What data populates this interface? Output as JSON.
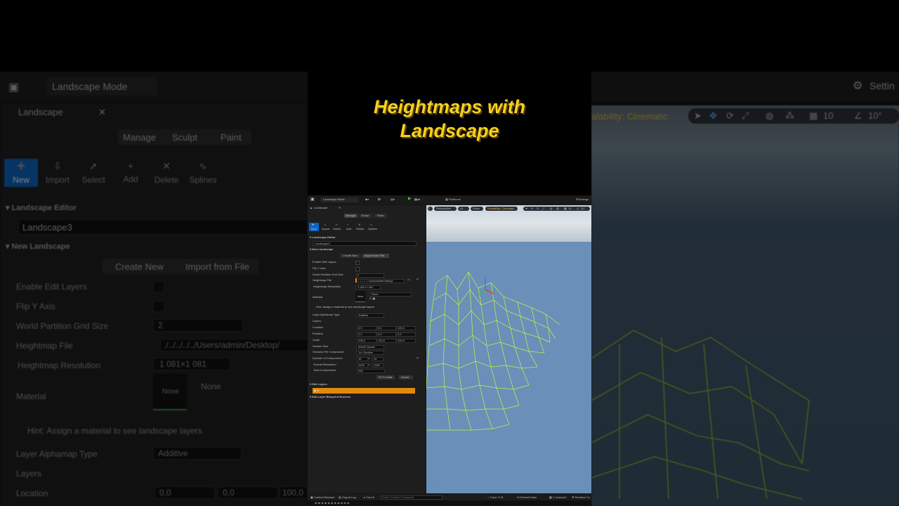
{
  "title": {
    "line1": "Heightmaps with",
    "line2": "Landscape"
  },
  "background": {
    "mode_label": "Landscape Mode",
    "settings_label": "Settin",
    "scalability_label": "alability: Cinematic",
    "panel_tab": "Landscape",
    "tabs": [
      "Manage",
      "Sculpt",
      "Paint"
    ],
    "tools": [
      "New",
      "Import",
      "Select",
      "Add",
      "Delete",
      "Splines"
    ],
    "section_editor": "Landscape Editor",
    "landscape_name": "Landscape3",
    "section_new": "New Landscape",
    "create_new": "Create New",
    "import_from_file": "Import from File",
    "rows": {
      "enable_edit_layers": "Enable Edit Layers",
      "flip_y": "Flip Y Axis",
      "grid_size": "World Partition Grid Size",
      "grid_size_value": "2",
      "heightmap_file": "Heightmap File",
      "heightmap_path": "./../../../../Users/admin/Desktop/",
      "heightmap_resolution": "Heightmap Resolution",
      "heightmap_resolution_value": "1 081×1 081",
      "material": "Material",
      "material_none": "None",
      "material_value": "None",
      "hint": "Hint: Assign a material to see landscape layers",
      "alphamap": "Layer Alphamap Type",
      "alphamap_value": "Additive",
      "layers": "Layers",
      "location": "Location",
      "loc_x": "0,0",
      "loc_y": "0,0",
      "loc_z": "100,0"
    },
    "grid_value": "10",
    "angle_value": "10°"
  },
  "editor": {
    "toolbar": {
      "mode": "Landscape Mode",
      "platforms": "Platforms",
      "settings": "Settings"
    },
    "panel_tab": "Landscape",
    "tabs": [
      "Manage",
      "Sculpt",
      "Paint"
    ],
    "tools": [
      "New",
      "Import",
      "Select",
      "Add",
      "Delete",
      "Splines"
    ],
    "section_editor": "Landscape Editor",
    "landscape_name": "Landscape3",
    "section_new": "New Landscape",
    "create_new": "Create New",
    "import_from_file": "Import from File",
    "rows": [
      {
        "label": "Enable Edit Layers",
        "value": ""
      },
      {
        "label": "Flip Y Axis",
        "value": ""
      },
      {
        "label": "World Partition Grid Size",
        "value": "2"
      },
      {
        "label": "Heightmap File",
        "value": "./../../../../Users/admin/Desktop/"
      },
      {
        "label": "Heightmap Resolution",
        "value": "1 081×1 081"
      },
      {
        "label": "Material",
        "value": "None"
      }
    ],
    "hint": "Hint: Assign a material to see landscape layers",
    "alphamap_label": "Layer Alphamap Type",
    "alphamap_value": "Additive",
    "layers_label": "Layers",
    "location": {
      "label": "Location",
      "x": "0,0",
      "y": "0,0",
      "z": "100,0"
    },
    "rotation": {
      "label": "Rotation",
      "x": "0,0",
      "y": "0,0",
      "z": "0,0"
    },
    "scale": {
      "label": "Scale",
      "x": "100,0",
      "y": "100,0",
      "z": "100,0"
    },
    "section_size": {
      "label": "Section Size",
      "value": "63x63 Quads"
    },
    "sections_per_component": {
      "label": "Sections Per Component",
      "value": "1x1 Section"
    },
    "num_components": {
      "label": "Number of Components",
      "x": "16",
      "y": "16"
    },
    "overall_resolution": {
      "label": "Overall Resolution",
      "x": "1009",
      "y": "1009"
    },
    "total_components": {
      "label": "Total Components",
      "value": "256"
    },
    "fit_to_data": "Fit To Data",
    "import": "Import",
    "edit_layers": "Edit Layers",
    "edit_layer_brushes": "Edit Layer Blueprint Brushes",
    "viewport": {
      "perspective": "Perspective",
      "lit": "Lit",
      "show": "Show",
      "scalability": "Scalability: Cinematic",
      "grid": "10",
      "angle": "10°"
    },
    "bottom": {
      "content_browser": "Content Browser",
      "output_log": "Output Log",
      "cmd": "Cmd",
      "console_placeholder": "Enter Console Command",
      "trace": "Trace",
      "derived_data": "Derived Data",
      "unsaved": "1 Unsaved",
      "revision": "Revision Co"
    }
  }
}
